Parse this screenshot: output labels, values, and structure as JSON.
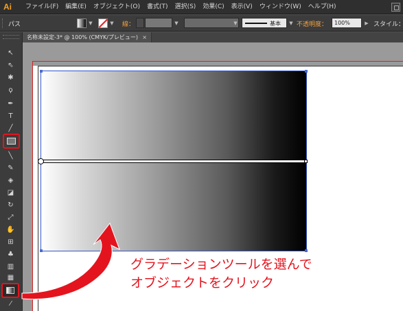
{
  "app": {
    "logo": "Ai"
  },
  "menu": [
    "ファイル(F)",
    "編集(E)",
    "オブジェクト(O)",
    "書式(T)",
    "選択(S)",
    "効果(C)",
    "表示(V)",
    "ウィンドウ(W)",
    "ヘルプ(H)"
  ],
  "controlbar": {
    "mode": "パス",
    "stroke_label": "線：",
    "brush_label": "基本",
    "opacity_label": "不透明度：",
    "opacity_value": "100%",
    "style_label": "スタイル："
  },
  "document": {
    "tab_title": "名称未設定-3* @ 100% (CMYK/プレビュー)",
    "close_glyph": "×"
  },
  "tools": {
    "active_selected": "gradient-tool",
    "highlighted": [
      "rectangle-tool",
      "gradient-tool"
    ]
  },
  "annotation": {
    "line1": "グラデーションツールを選んで",
    "line2": "オブジェクトをクリック",
    "color": "#e4141e"
  },
  "object": {
    "fill": "linear gradient white to black"
  }
}
